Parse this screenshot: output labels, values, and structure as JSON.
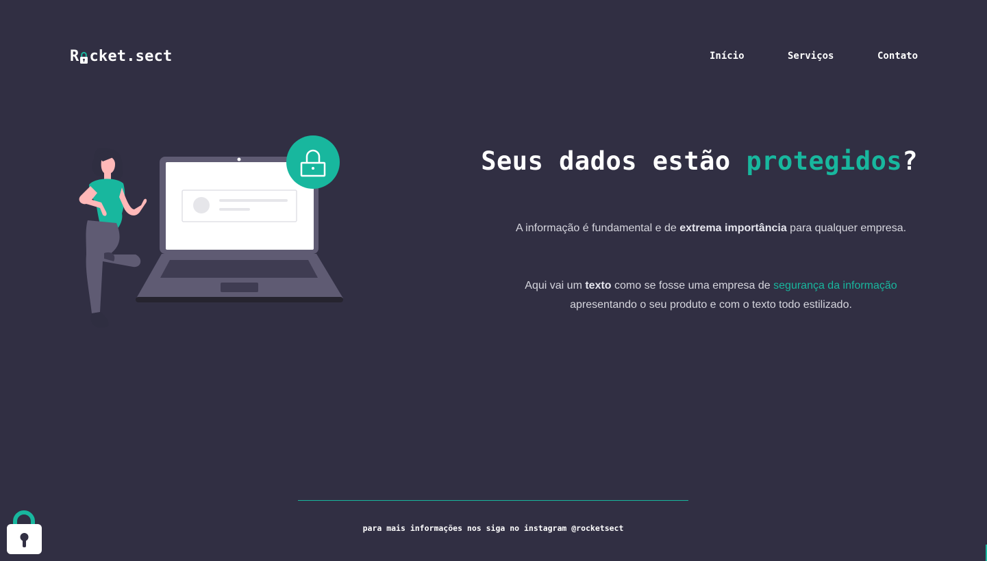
{
  "header": {
    "logo_prefix": "R",
    "logo_suffix": "cket.sect",
    "logo_icon": "lock-icon",
    "nav": [
      "Início",
      "Serviços",
      "Contato"
    ]
  },
  "hero": {
    "title_prefix": "Seus dados estão ",
    "title_accent": "protegidos",
    "title_suffix": "?",
    "p1": {
      "pre": "A informação é fundamental e de ",
      "bold": "extrema importância",
      "post": " para qualquer empresa."
    },
    "p2": {
      "pre": "Aqui vai um ",
      "bold": "texto",
      "mid": " como se fosse uma empresa de ",
      "link": "segurança da informação",
      "post": " apresentando o seu produto e com o texto todo estilizado."
    }
  },
  "footer": {
    "text": "para mais informações nos siga no instagram @rocketsect"
  },
  "floating_icon": "padlock-icon",
  "colors": {
    "background": "#312f43",
    "accent": "#18b79e",
    "text": "#ffffff",
    "laptop": "#5f5b73",
    "shirt": "#18b79e",
    "skin": "#ffb8b8"
  }
}
